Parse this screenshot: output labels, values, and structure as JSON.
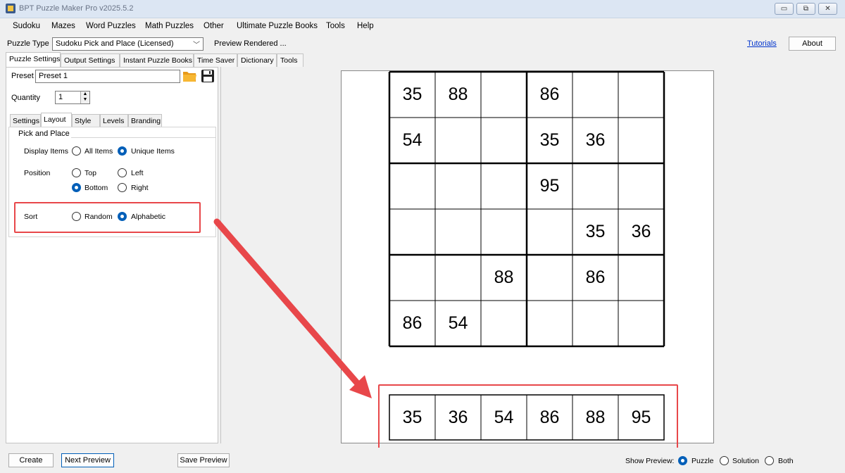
{
  "window": {
    "title": "BPT Puzzle Maker Pro v2025.5.2",
    "controls": [
      "▭",
      "⧉",
      "✕"
    ]
  },
  "menu": [
    "Sudoku",
    "Mazes",
    "Word Puzzles",
    "Math Puzzles",
    "Other",
    "Ultimate Puzzle Books",
    "Tools",
    "Help"
  ],
  "puzzle_type": {
    "label": "Puzzle Type",
    "value": "Sudoku Pick and Place (Licensed)",
    "status": "Preview Rendered ..."
  },
  "header_right": {
    "tutorials": "Tutorials",
    "about": "About"
  },
  "main_tabs": [
    "Puzzle Settings",
    "Output Settings",
    "Instant Puzzle Books",
    "Time Saver",
    "Dictionary",
    "Tools"
  ],
  "preset": {
    "label": "Preset",
    "value": "Preset 1"
  },
  "quantity": {
    "label": "Quantity",
    "value": "1"
  },
  "sub_tabs": [
    "Settings",
    "Layout",
    "Style",
    "Levels",
    "Branding"
  ],
  "layout": {
    "group_title": "Pick and Place",
    "display_items": {
      "label": "Display Items",
      "options": [
        "All Items",
        "Unique Items"
      ],
      "selected": "Unique Items"
    },
    "position": {
      "label": "Position",
      "options": [
        "Top",
        "Left",
        "Bottom",
        "Right"
      ],
      "selected": "Bottom"
    },
    "sort": {
      "label": "Sort",
      "options": [
        "Random",
        "Alphabetic"
      ],
      "selected": "Alphabetic"
    }
  },
  "puzzle_grid": [
    [
      "35",
      "88",
      "",
      "86",
      "",
      ""
    ],
    [
      "54",
      "",
      "",
      "35",
      "36",
      ""
    ],
    [
      "",
      "",
      "",
      "95",
      "",
      ""
    ],
    [
      "",
      "",
      "",
      "",
      "35",
      "36"
    ],
    [
      "",
      "",
      "88",
      "",
      "86",
      ""
    ],
    [
      "86",
      "54",
      "",
      "",
      "",
      ""
    ]
  ],
  "pick_items": [
    "35",
    "36",
    "54",
    "86",
    "88",
    "95"
  ],
  "bottom": {
    "create": "Create",
    "next_preview": "Next Preview",
    "save_preview": "Save Preview",
    "show_preview_label": "Show Preview:",
    "show_preview_options": [
      "Puzzle",
      "Solution",
      "Both"
    ],
    "show_preview_selected": "Puzzle"
  },
  "colors": {
    "accent": "#005fb8",
    "highlight": "#e8474a",
    "link": "#0033cc"
  }
}
